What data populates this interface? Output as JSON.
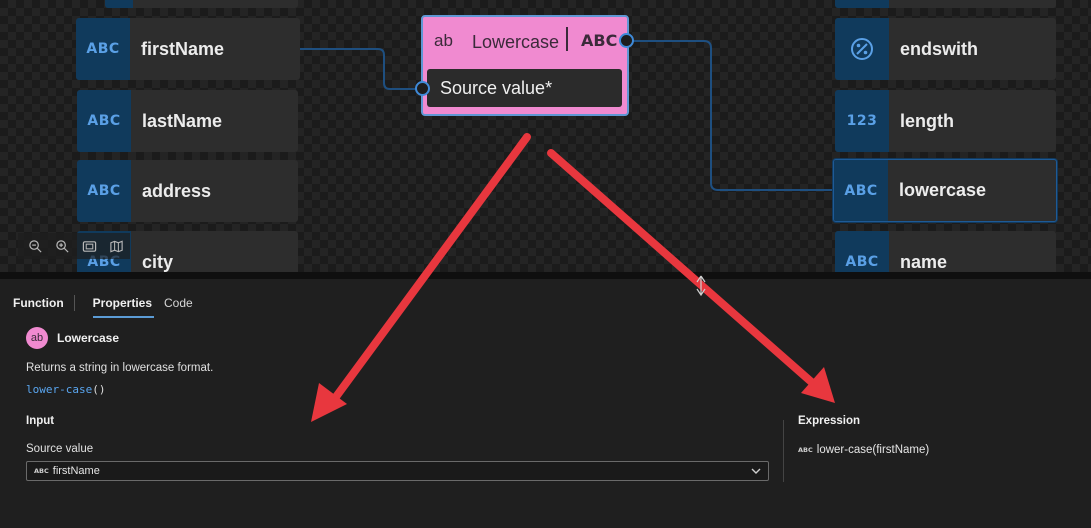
{
  "left_nodes": [
    {
      "type": "ABC",
      "label": "firstName",
      "selected": true
    },
    {
      "type": "ABC",
      "label": "lastName",
      "selected": false
    },
    {
      "type": "ABC",
      "label": "address",
      "selected": false
    },
    {
      "type": "ABC",
      "label": "city",
      "selected": false
    }
  ],
  "right_nodes": [
    {
      "type": "percent-icon",
      "label": "endswith",
      "selected": false
    },
    {
      "type": "123",
      "label": "length",
      "selected": false
    },
    {
      "type": "ABC",
      "label": "lowercase",
      "selected": true
    },
    {
      "type": "ABC",
      "label": "name",
      "selected": false
    }
  ],
  "function_node": {
    "input_type": "ab",
    "title": "Lowercase",
    "return_type": "ABC",
    "input_label": "Source value*",
    "color": "#f08ad0"
  },
  "zoom_controls": [
    "zoom-out-icon",
    "zoom-in-icon",
    "fit-to-screen-icon",
    "minimap-icon"
  ],
  "panel": {
    "tabs": {
      "function": "Function",
      "properties": "Properties",
      "code": "Code"
    },
    "function_icon": "ab",
    "function_name": "Lowercase",
    "description": "Returns a string in lowercase format.",
    "signature_name": "lower-case",
    "signature_parens": "()",
    "input_title": "Input",
    "source_label": "Source value",
    "source_type": "ABC",
    "source_value": "firstName",
    "expression_title": "Expression",
    "expression_type": "ABC",
    "expression_value": "lower-case(firstName)"
  },
  "colors": {
    "accent": "#5b9bd5",
    "type_badge": "#103a5c",
    "annotation_arrow": "#e8373e"
  }
}
